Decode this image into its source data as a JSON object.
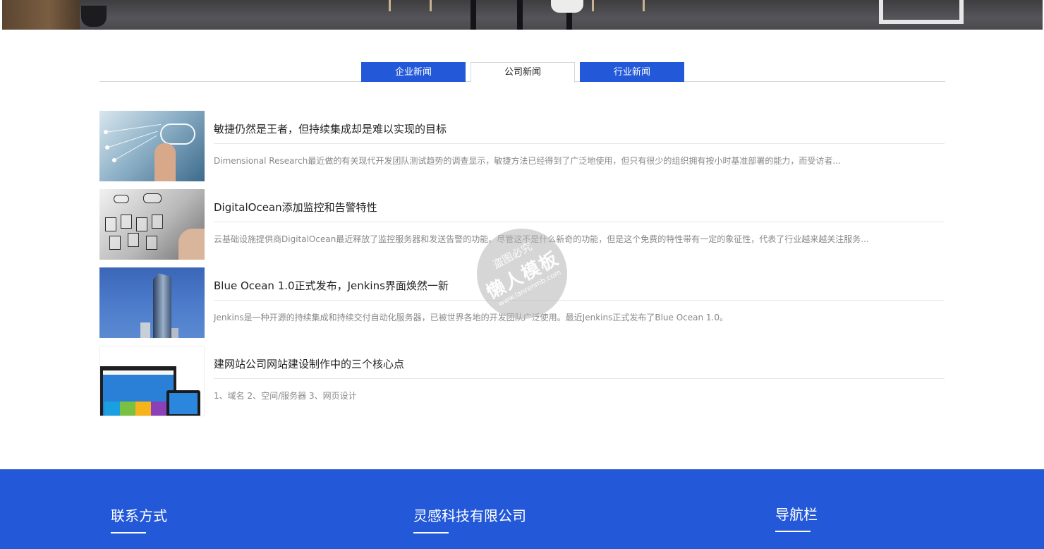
{
  "tabs": [
    {
      "label": "企业新闻",
      "active": false
    },
    {
      "label": "公司新闻",
      "active": true
    },
    {
      "label": "行业新闻",
      "active": false
    }
  ],
  "news": [
    {
      "title": "敏捷仍然是王者，但持续集成却是难以实现的目标",
      "desc": "Dimensional Research最近做的有关现代开发团队测试趋势的调查显示，敏捷方法已经得到了广泛地使用，但只有很少的组织拥有按小时基准部署的能力，而受访者..."
    },
    {
      "title": "DigitalOcean添加监控和告警特性",
      "desc": "云基础设施提供商DigitalOcean最近释放了监控服务器和发送告警的功能。尽管这不是什么新奇的功能，但是这个免费的特性带有一定的象征性，代表了行业越来越关注服务..."
    },
    {
      "title": "Blue Ocean 1.0正式发布，Jenkins界面焕然一新",
      "desc": "Jenkins是一种开源的持续集成和持续交付自动化服务器，已被世界各地的开发团队广泛使用。最近Jenkins正式发布了Blue Ocean 1.0。"
    },
    {
      "title": "建网站公司网站建设制作中的三个核心点",
      "desc": "1、域名 2、空间/服务器 3、网页设计"
    }
  ],
  "watermark": {
    "line1": "盗图必究",
    "line2": "懒人模板",
    "line3": "www.lanrenmb.com"
  },
  "footer": {
    "contact_heading": "联系方式",
    "company_heading": "灵感科技有限公司",
    "nav_heading": "导航栏"
  },
  "colors": {
    "accent": "#2358d8",
    "text": "#222222",
    "muted": "#888888"
  }
}
